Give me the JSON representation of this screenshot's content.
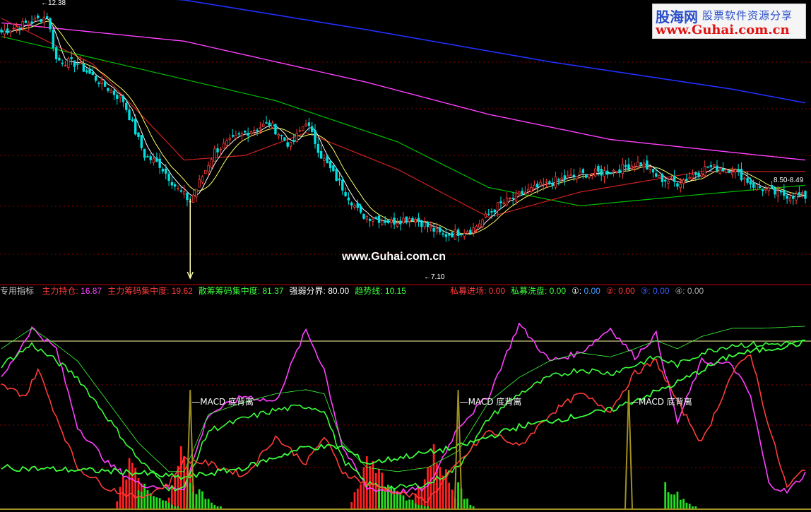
{
  "logo": {
    "brand": "股海网",
    "tagline": "股票软件资源分享",
    "url": "www.Guhai.com.cn"
  },
  "watermark": "www.Guhai.com.cn",
  "price_panel": {
    "high_label": "12.38",
    "low_label": "7.10",
    "ma_readout": "8.50",
    "ma_readout_2": "8.49"
  },
  "indicator_bar": {
    "title": "专用指标",
    "items": [
      {
        "label": "主力持仓:",
        "value": "16.87",
        "label_color": "#ff3b3b",
        "value_color": "#ff40ff"
      },
      {
        "label": "主力筹码集中度:",
        "value": "19.62",
        "label_color": "#ff3b3b",
        "value_color": "#ff3b3b"
      },
      {
        "label": "散筹筹码集中度:",
        "value": "81.37",
        "label_color": "#3cff3c",
        "value_color": "#3cff3c"
      },
      {
        "label": "强弱分界:",
        "value": "80.00",
        "label_color": "#ffffff",
        "value_color": "#ffffff"
      },
      {
        "label": "趋势线:",
        "value": "10.15",
        "label_color": "#3cff3c",
        "value_color": "#3cff3c"
      },
      {
        "label": "私募进场:",
        "value": "0.00",
        "label_color": "#ff3b3b",
        "value_color": "#ff3b3b"
      },
      {
        "label": "私募洗盘:",
        "value": "0.00",
        "label_color": "#3cff3c",
        "value_color": "#3cff3c"
      },
      {
        "label": "①:",
        "value": "0.00",
        "label_color": "#ffffff",
        "value_color": "#3c9cff"
      },
      {
        "label": "②:",
        "value": "0.00",
        "label_color": "#ff3b3b",
        "value_color": "#ff3b3b"
      },
      {
        "label": "③:",
        "value": "0.00",
        "label_color": "#3c5cff",
        "value_color": "#3c5cff"
      },
      {
        "label": "④:",
        "value": "0.00",
        "label_color": "#aaaaaa",
        "value_color": "#aaaaaa"
      }
    ]
  },
  "annotations": [
    {
      "text": "MACD 底背离",
      "bar_index": 62
    },
    {
      "text": "MACD 底背离",
      "bar_index": 150
    },
    {
      "text": "MACD 底背离",
      "bar_index": 206
    }
  ],
  "colors": {
    "background": "#000000",
    "up_candle": "#ff3b3b",
    "down_candle": "#00e0e0",
    "grid": "#8b0000",
    "ma5": "#ffffff",
    "ma10": "#ffff66",
    "ma20": "#ff40ff",
    "ma60": "#00c000",
    "ma250": "#2030ff",
    "ma_red": "#d02020",
    "divider": "#c00000"
  },
  "chart_data": [
    {
      "type": "candlestick",
      "title": "",
      "price_range": [
        7.1,
        12.38
      ],
      "x_count": 265,
      "close_anchors": [
        [
          0,
          11.9
        ],
        [
          15,
          12.25
        ],
        [
          18,
          11.3
        ],
        [
          25,
          11.2
        ],
        [
          40,
          10.4
        ],
        [
          47,
          9.2
        ],
        [
          52,
          9.0
        ],
        [
          58,
          8.45
        ],
        [
          62,
          8.2
        ],
        [
          70,
          9.3
        ],
        [
          80,
          9.7
        ],
        [
          88,
          9.9
        ],
        [
          95,
          9.4
        ],
        [
          100,
          9.95
        ],
        [
          105,
          9.2
        ],
        [
          112,
          8.5
        ],
        [
          118,
          7.9
        ],
        [
          128,
          7.75
        ],
        [
          135,
          7.85
        ],
        [
          145,
          7.45
        ],
        [
          155,
          7.6
        ],
        [
          163,
          8.1
        ],
        [
          172,
          8.4
        ],
        [
          182,
          8.65
        ],
        [
          192,
          8.8
        ],
        [
          200,
          8.85
        ],
        [
          210,
          9.05
        ],
        [
          216,
          8.7
        ],
        [
          222,
          8.6
        ],
        [
          232,
          8.95
        ],
        [
          240,
          8.9
        ],
        [
          247,
          8.55
        ],
        [
          255,
          8.35
        ],
        [
          264,
          8.3
        ]
      ],
      "ma250_anchors": [
        [
          0,
          12.9
        ],
        [
          60,
          12.6
        ],
        [
          120,
          11.95
        ],
        [
          180,
          11.25
        ],
        [
          240,
          10.65
        ],
        [
          264,
          10.35
        ]
      ],
      "ma120_anchors": [
        [
          0,
          12.1
        ],
        [
          60,
          11.7
        ],
        [
          120,
          10.8
        ],
        [
          160,
          10.1
        ],
        [
          200,
          9.55
        ],
        [
          264,
          9.1
        ]
      ],
      "ma60_anchors": [
        [
          0,
          11.8
        ],
        [
          45,
          11.1
        ],
        [
          90,
          10.4
        ],
        [
          130,
          9.5
        ],
        [
          160,
          8.5
        ],
        [
          190,
          8.1
        ],
        [
          230,
          8.35
        ],
        [
          264,
          8.55
        ]
      ],
      "ma30_anchors": [
        [
          0,
          12.2
        ],
        [
          30,
          11.2
        ],
        [
          60,
          9.1
        ],
        [
          80,
          9.2
        ],
        [
          100,
          9.7
        ],
        [
          130,
          8.9
        ],
        [
          160,
          7.85
        ],
        [
          190,
          8.4
        ],
        [
          230,
          8.85
        ],
        [
          264,
          8.85
        ]
      ]
    },
    {
      "type": "line",
      "title": "专用指标",
      "ylim": [
        0,
        100
      ],
      "reference_line": 80,
      "series": [
        {
          "name": "主力持仓",
          "color": "#ff40ff",
          "anchors": [
            [
              0,
              63
            ],
            [
              10,
              88
            ],
            [
              18,
              78
            ],
            [
              25,
              40
            ],
            [
              35,
              22
            ],
            [
              45,
              12
            ],
            [
              55,
              10
            ],
            [
              60,
              10
            ],
            [
              68,
              46
            ],
            [
              80,
              55
            ],
            [
              90,
              52
            ],
            [
              100,
              87
            ],
            [
              106,
              68
            ],
            [
              112,
              30
            ],
            [
              120,
              10
            ],
            [
              130,
              8
            ],
            [
              140,
              10
            ],
            [
              150,
              40
            ],
            [
              160,
              55
            ],
            [
              170,
              90
            ],
            [
              180,
              72
            ],
            [
              190,
              76
            ],
            [
              200,
              88
            ],
            [
              208,
              74
            ],
            [
              215,
              85
            ],
            [
              222,
              42
            ],
            [
              230,
              72
            ],
            [
              240,
              70
            ],
            [
              246,
              55
            ],
            [
              252,
              12
            ],
            [
              258,
              8
            ],
            [
              264,
              17
            ]
          ]
        },
        {
          "name": "散筹筹码集中度",
          "color": "#3cff3c",
          "anchors": [
            [
              0,
              70
            ],
            [
              10,
              80
            ],
            [
              18,
              72
            ],
            [
              25,
              64
            ],
            [
              35,
              44
            ],
            [
              45,
              24
            ],
            [
              55,
              10
            ],
            [
              60,
              10
            ],
            [
              68,
              38
            ],
            [
              80,
              44
            ],
            [
              90,
              48
            ],
            [
              100,
              50
            ],
            [
              106,
              48
            ],
            [
              112,
              24
            ],
            [
              120,
              12
            ],
            [
              130,
              10
            ],
            [
              140,
              12
            ],
            [
              150,
              20
            ],
            [
              160,
              44
            ],
            [
              170,
              56
            ],
            [
              180,
              64
            ],
            [
              190,
              68
            ],
            [
              200,
              66
            ],
            [
              208,
              70
            ],
            [
              215,
              74
            ],
            [
              222,
              70
            ],
            [
              230,
              76
            ],
            [
              240,
              80
            ],
            [
              250,
              80
            ],
            [
              264,
              81
            ]
          ]
        },
        {
          "name": "主力筹码集中度",
          "color": "#ff3b3b",
          "anchors": [
            [
              0,
              60
            ],
            [
              8,
              55
            ],
            [
              12,
              68
            ],
            [
              18,
              45
            ],
            [
              25,
              20
            ],
            [
              35,
              10
            ],
            [
              45,
              5
            ],
            [
              55,
              12
            ],
            [
              60,
              24
            ],
            [
              68,
              22
            ],
            [
              80,
              16
            ],
            [
              90,
              35
            ],
            [
              100,
              22
            ],
            [
              106,
              35
            ],
            [
              112,
              18
            ],
            [
              120,
              12
            ],
            [
              130,
              8
            ],
            [
              140,
              4
            ],
            [
              150,
              22
            ],
            [
              160,
              38
            ],
            [
              170,
              30
            ],
            [
              180,
              46
            ],
            [
              190,
              56
            ],
            [
              200,
              48
            ],
            [
              208,
              66
            ],
            [
              215,
              72
            ],
            [
              222,
              52
            ],
            [
              230,
              32
            ],
            [
              240,
              66
            ],
            [
              246,
              76
            ],
            [
              252,
              40
            ],
            [
              258,
              10
            ],
            [
              264,
              20
            ]
          ]
        },
        {
          "name": "趋势线",
          "color": "#3cff3c",
          "anchors": [
            [
              0,
              20
            ],
            [
              40,
              18
            ],
            [
              60,
              15
            ],
            [
              80,
              20
            ],
            [
              100,
              30
            ],
            [
              112,
              30
            ],
            [
              120,
              22
            ],
            [
              150,
              30
            ],
            [
              170,
              40
            ],
            [
              200,
              48
            ],
            [
              220,
              60
            ],
            [
              240,
              75
            ],
            [
              264,
              81
            ]
          ]
        }
      ],
      "histogram": {
        "red_clusters": [
          [
            38,
            48
          ],
          [
            55,
            64
          ],
          [
            115,
            128
          ],
          [
            135,
            150
          ]
        ],
        "green_clusters": [
          [
            45,
            58
          ],
          [
            62,
            72
          ],
          [
            124,
            140
          ],
          [
            150,
            155
          ],
          [
            218,
            228
          ]
        ]
      }
    }
  ]
}
